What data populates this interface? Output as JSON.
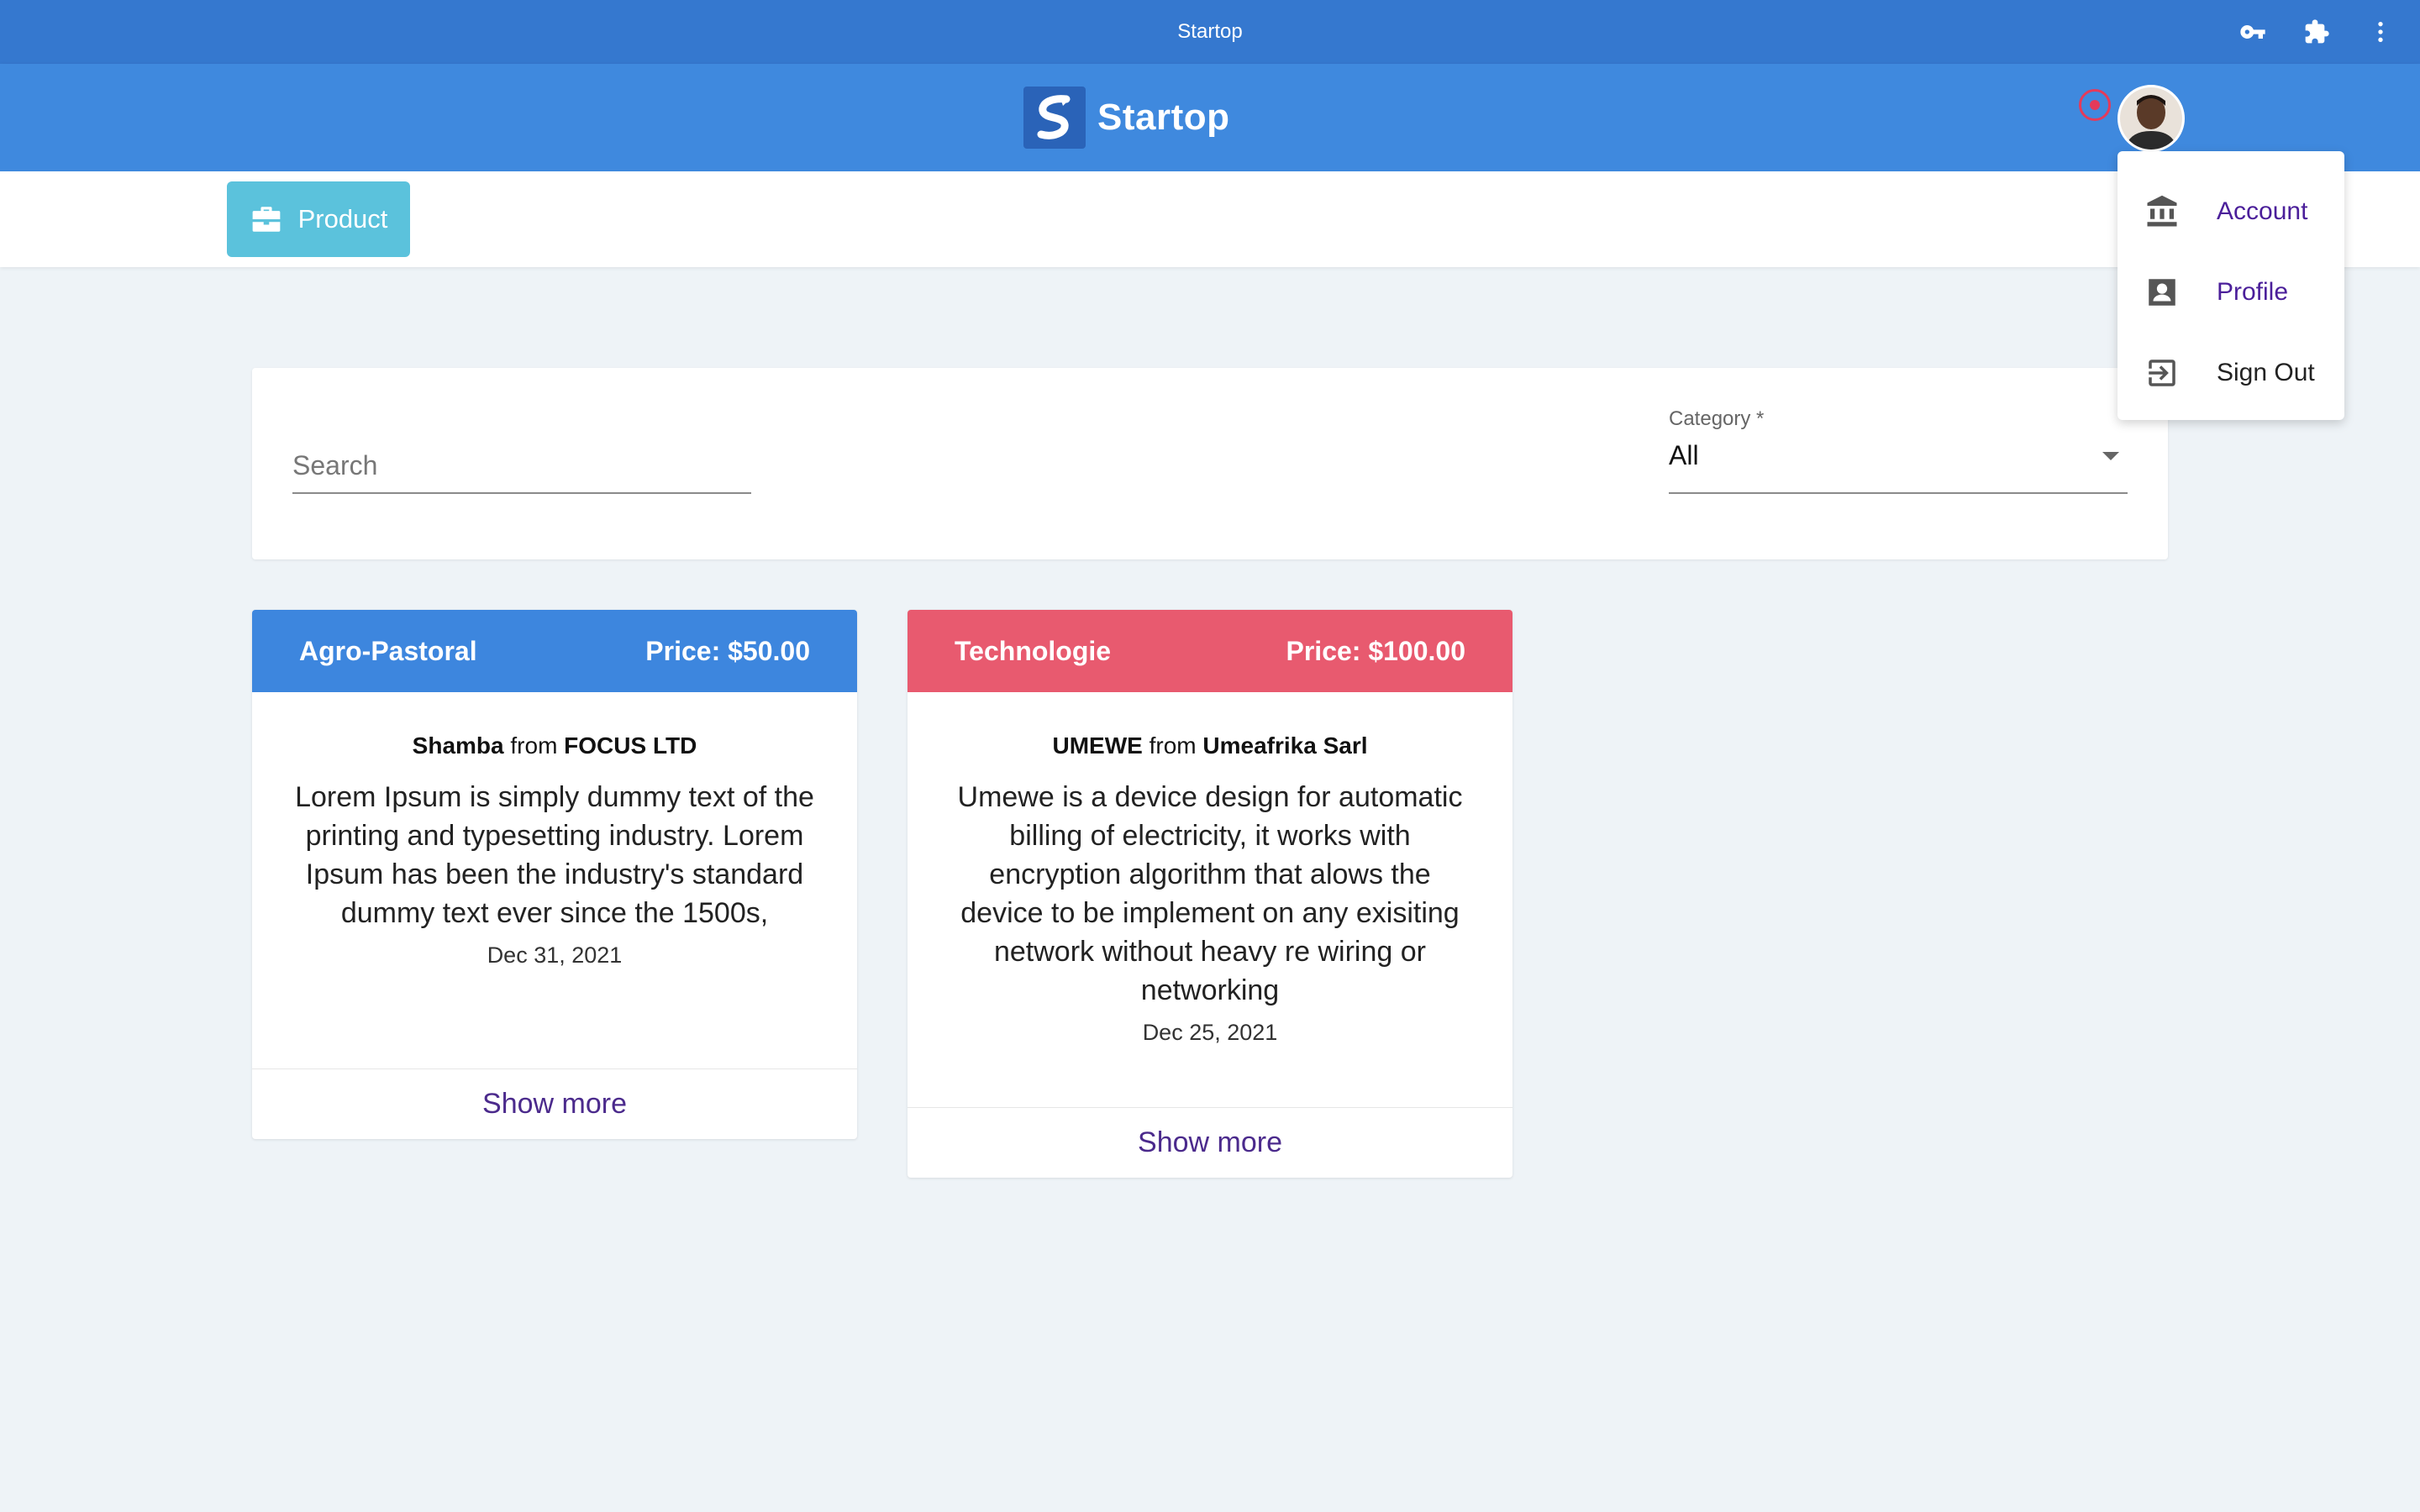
{
  "window": {
    "title": "Startop"
  },
  "chrome_icons": [
    "key-icon",
    "puzzle-icon",
    "more-vert-icon"
  ],
  "header": {
    "brand": "Startop"
  },
  "subnav": {
    "product_label": "Product"
  },
  "filters": {
    "search_placeholder": "Search",
    "category_label": "Category *",
    "category_value": "All"
  },
  "cards": [
    {
      "category": "Agro-Pastoral",
      "price": "Price: $50.00",
      "name": "Shamba",
      "from": "from",
      "company": "FOCUS LTD",
      "description": "Lorem Ipsum is simply dummy text of the printing and typesetting industry. Lorem Ipsum has been the industry's standard dummy text ever since the 1500s,",
      "date": "Dec 31, 2021",
      "show_more": "Show more",
      "color": "#3d86de"
    },
    {
      "category": "Technologie",
      "price": "Price: $100.00",
      "name": "UMEWE",
      "from": "from",
      "company": "Umeafrika Sarl",
      "description": "Umewe is a device design for automatic billing of electricity, it works with encryption algorithm that alows the device to be implement on any exisiting network without heavy re wiring or networking",
      "date": "Dec 25, 2021",
      "show_more": "Show more",
      "color": "#e85a6f"
    }
  ],
  "user_menu": {
    "items": [
      {
        "label": "Account",
        "icon": "bank-icon"
      },
      {
        "label": "Profile",
        "icon": "profile-icon"
      },
      {
        "label": "Sign Out",
        "icon": "sign-out-icon"
      }
    ]
  }
}
